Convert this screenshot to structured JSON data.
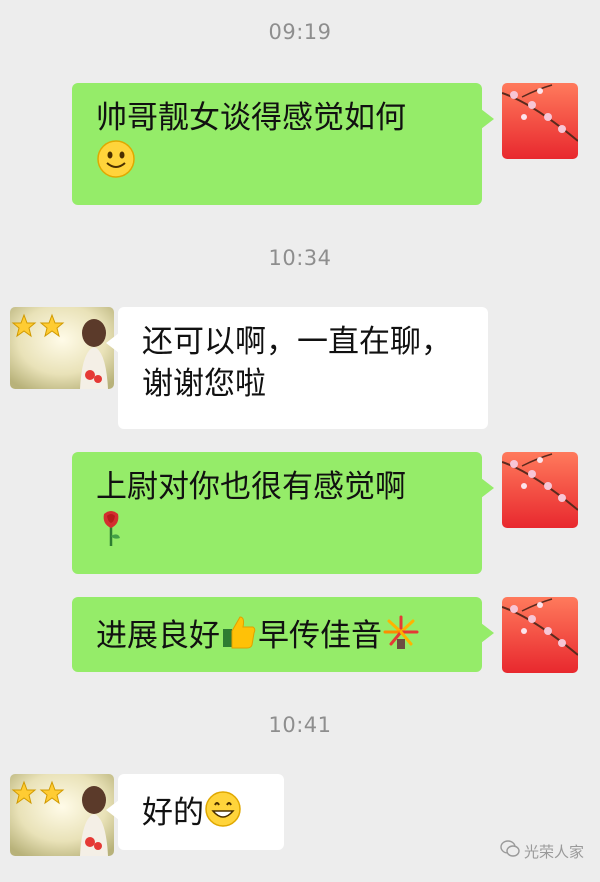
{
  "chat": {
    "time_1": "09:19",
    "time_2": "10:34",
    "time_3": "10:41",
    "messages": [
      {
        "text": "帅哥靓女谈得感觉如何",
        "emoji": "smile-emoji"
      },
      {
        "text_line1": "还可以啊，一直在聊，",
        "text_line2": "谢谢您啦"
      },
      {
        "text": "上尉对你也很有感觉啊",
        "emoji": "rose-emoji"
      },
      {
        "text_a": "进展良好",
        "text_b": "早传佳音",
        "emoji1": "thumbs-up-emoji",
        "emoji2": "fireworks-emoji"
      },
      {
        "text": "好的",
        "emoji": "grin-emoji"
      }
    ]
  },
  "watermark": {
    "label": "光荣人家"
  },
  "colors": {
    "outgoing_bubble": "#95ec69",
    "incoming_bubble": "#ffffff",
    "background": "#ededed"
  }
}
